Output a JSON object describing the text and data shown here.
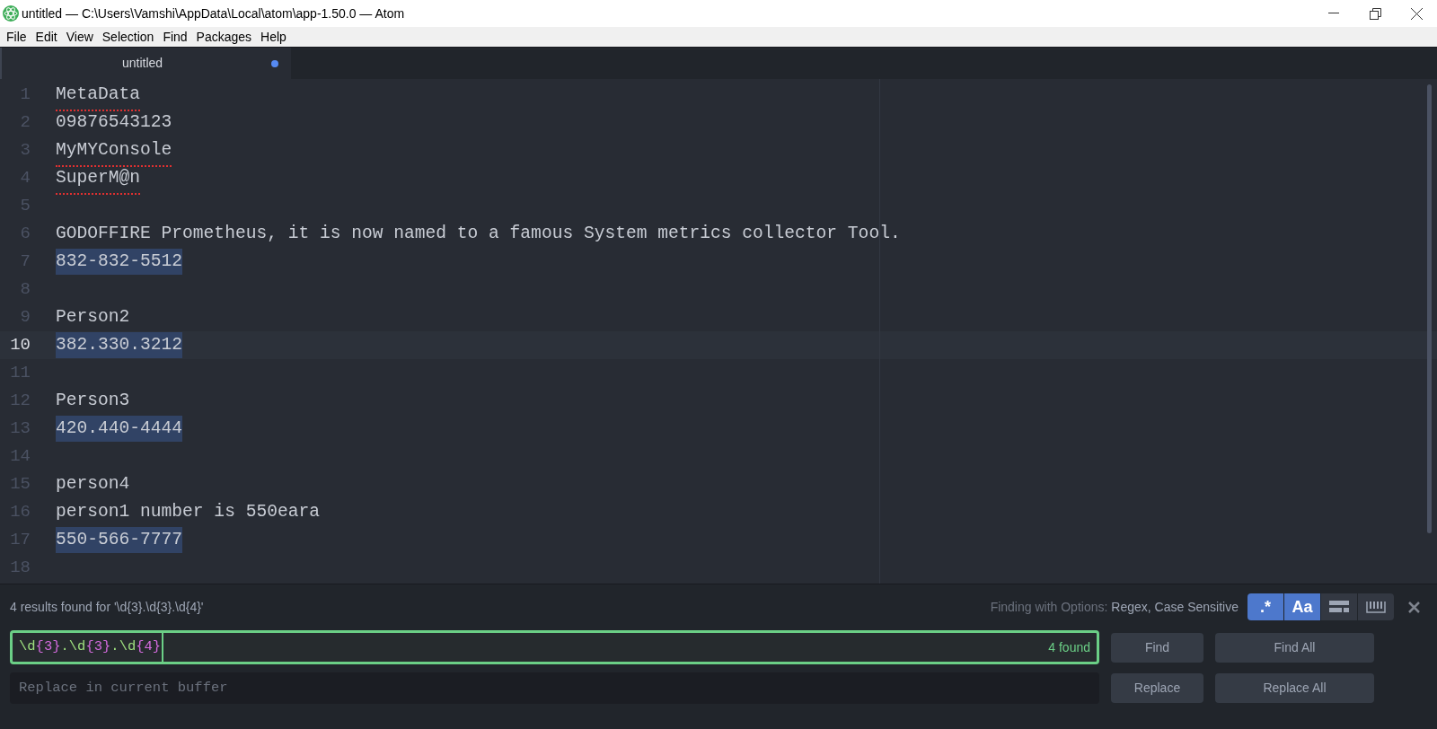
{
  "window": {
    "title": "untitled — C:\\Users\\Vamshi\\AppData\\Local\\atom\\app-1.50.0 — Atom"
  },
  "menu": [
    "File",
    "Edit",
    "View",
    "Selection",
    "Find",
    "Packages",
    "Help"
  ],
  "tabs": [
    {
      "label": "untitled",
      "modified": true,
      "selected": true
    }
  ],
  "editor": {
    "lines": [
      {
        "number": "1",
        "text": "MetaData",
        "misspelled": true,
        "match": false,
        "selected": false
      },
      {
        "number": "2",
        "text": "09876543123",
        "misspelled": false,
        "match": false,
        "selected": false
      },
      {
        "number": "3",
        "text": "MyMYConsole",
        "misspelled": true,
        "match": false,
        "selected": false
      },
      {
        "number": "4",
        "text": "SuperM@n",
        "misspelled": true,
        "match": false,
        "selected": false
      },
      {
        "number": "5",
        "selected": false
      },
      {
        "number": "6",
        "text": "GODOFFIRE Prometheus, it is now named to a famous System metrics collector Tool.",
        "misspelled": false,
        "match": false,
        "selected": false
      },
      {
        "number": "7",
        "text": "832-832-5512",
        "misspelled": false,
        "match": true,
        "selected": false
      },
      {
        "number": "8",
        "selected": false
      },
      {
        "number": "9",
        "text": "Person2",
        "misspelled": false,
        "match": false,
        "selected": false
      },
      {
        "number": "10",
        "text": "382.330.3212",
        "misspelled": false,
        "match": true,
        "selected": true
      },
      {
        "number": "11",
        "selected": false
      },
      {
        "number": "12",
        "text": "Person3",
        "misspelled": false,
        "match": false,
        "selected": false
      },
      {
        "number": "13",
        "text": "420.440-4444",
        "misspelled": false,
        "match": true,
        "selected": false
      },
      {
        "number": "14",
        "selected": false
      },
      {
        "number": "15",
        "text": "person4",
        "misspelled": false,
        "match": false,
        "selected": false
      },
      {
        "number": "16",
        "text": "person1 number is 550eara",
        "misspelled": false,
        "match": false,
        "selected": false
      },
      {
        "number": "17",
        "text": "550-566-7777",
        "misspelled": false,
        "match": true,
        "selected": false
      },
      {
        "number": "18",
        "selected": false
      }
    ]
  },
  "find": {
    "results": "4 results found for '\\d{3}.\\d{3}.\\d{4}'",
    "options_label": "Finding with Options:",
    "options_value": "Regex, Case Sensitive",
    "toggles": [
      {
        "kind": "text",
        "label": ".*",
        "selected": true
      },
      {
        "kind": "text",
        "label": "Aa",
        "selected": true
      },
      {
        "kind": "selection",
        "selected": false
      },
      {
        "kind": "word",
        "selected": false
      }
    ],
    "find_field": {
      "value": "\\d{3}.\\d{3}.\\d{4}",
      "count": "4 found"
    },
    "replace_field": {
      "placeholder": "Replace in current buffer"
    },
    "buttons": [
      {
        "label": "Find",
        "wide": false
      },
      {
        "label": "Find All",
        "wide": true
      },
      {
        "label": "Replace",
        "wide": false
      },
      {
        "label": "Replace All",
        "wide": true
      }
    ]
  }
}
